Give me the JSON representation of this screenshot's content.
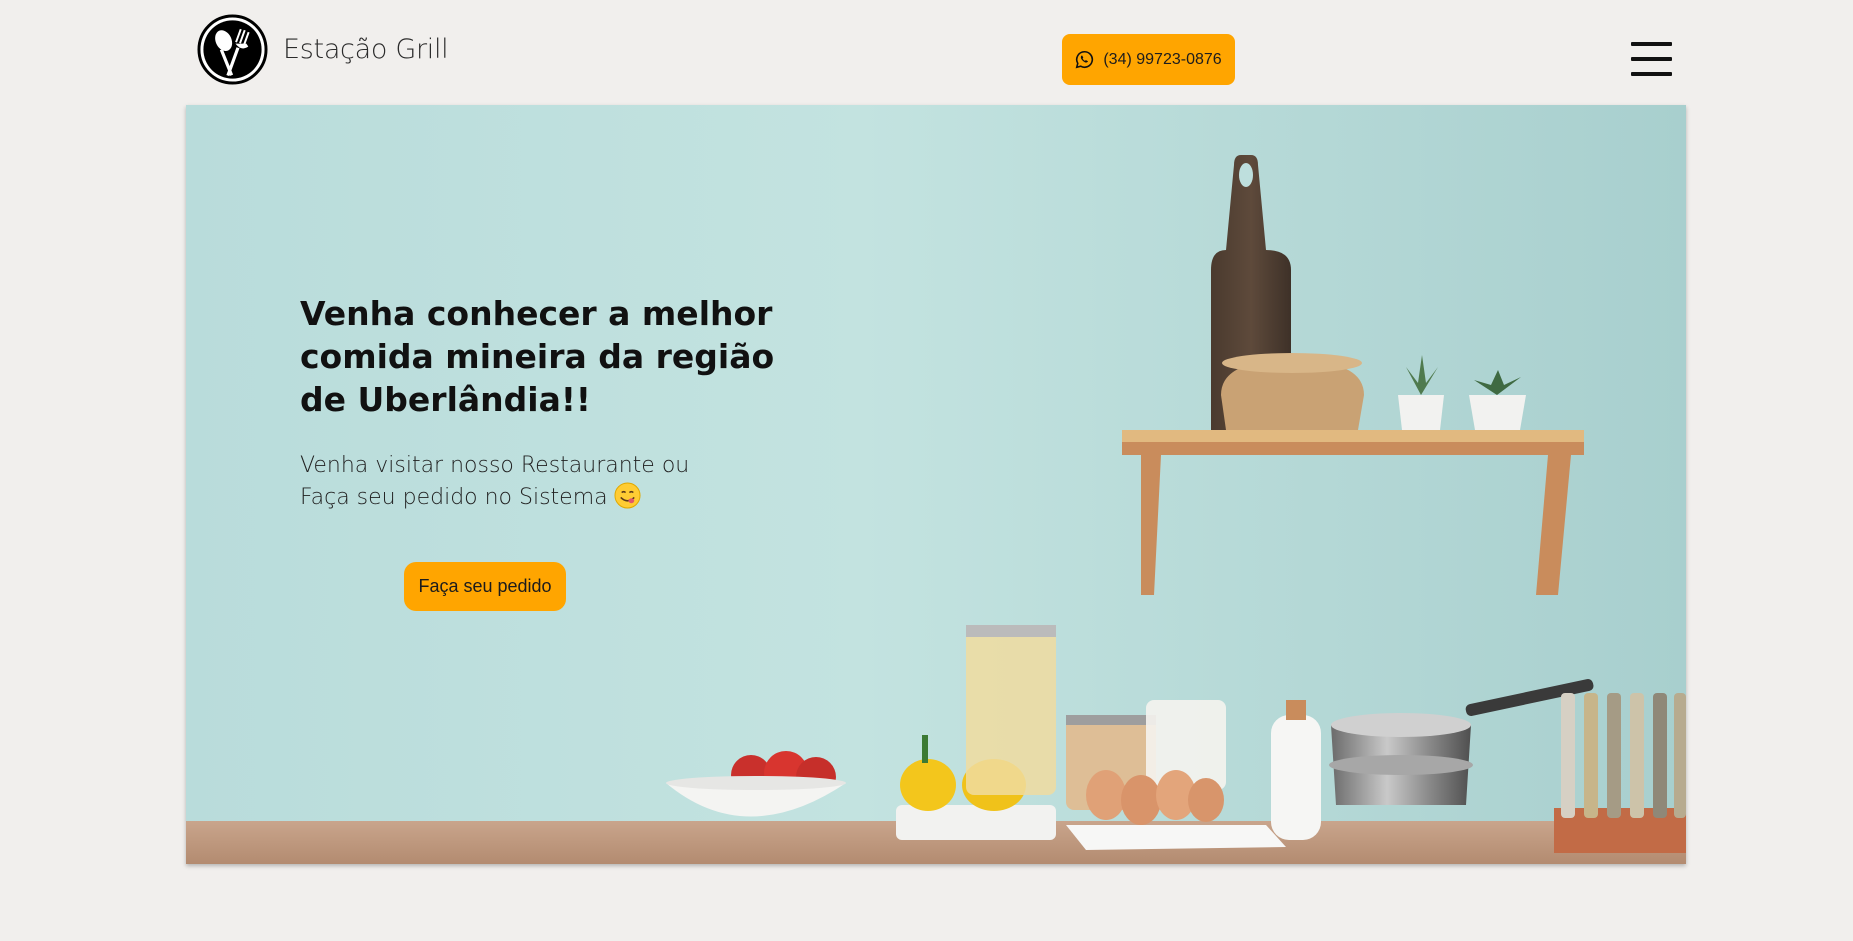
{
  "header": {
    "brand": "Estação Grill",
    "logo_icon": "spoon-fork-icon",
    "whatsapp": {
      "icon": "whatsapp-icon",
      "phone": "(34) 99723-0876"
    },
    "menu_icon": "hamburger-menu-icon"
  },
  "hero": {
    "title": "Venha conhecer a melhor comida mineira da região de Uberlândia!!",
    "subtitle_line1": "Venha visitar nosso Restaurante ou",
    "subtitle_line2": "Faça seu pedido no Sistema",
    "subtitle_emoji": "😋",
    "cta_label": "Faça seu pedido"
  },
  "colors": {
    "accent": "#ffa500",
    "background": "#f1efed",
    "hero_wall": "#bedfdd"
  }
}
